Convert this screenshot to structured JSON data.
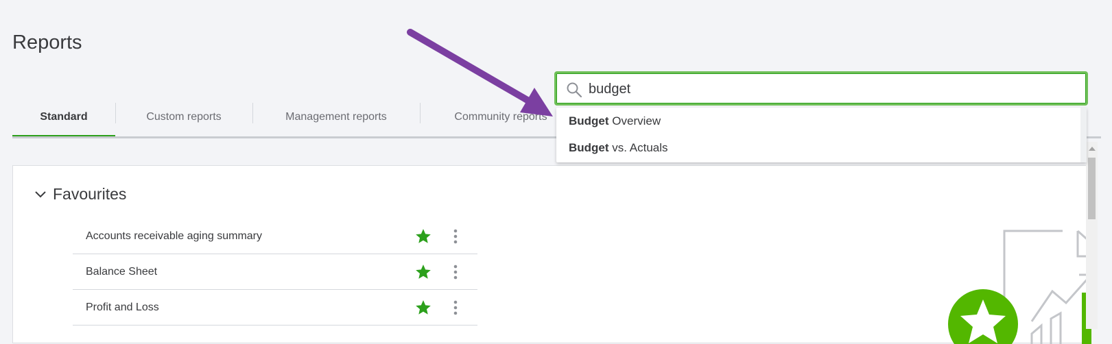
{
  "page": {
    "title": "Reports"
  },
  "tabs": [
    {
      "label": "Standard",
      "active": true
    },
    {
      "label": "Custom reports",
      "active": false
    },
    {
      "label": "Management reports",
      "active": false
    },
    {
      "label": "Community reports",
      "active": false
    }
  ],
  "search": {
    "value": "budget",
    "suggestions": [
      {
        "match": "Budget",
        "rest": " Overview"
      },
      {
        "match": "Budget",
        "rest": " vs. Actuals"
      }
    ]
  },
  "favourites": {
    "title": "Favourites",
    "items": [
      {
        "name": "Accounts receivable aging summary",
        "favourited": true
      },
      {
        "name": "Balance Sheet",
        "favourited": true
      },
      {
        "name": "Profit and Loss",
        "favourited": true
      }
    ]
  },
  "colors": {
    "accent": "#2ca01c",
    "annotation_arrow": "#7b3fa1"
  },
  "icons": [
    "search-icon",
    "chevron-down-icon",
    "star-icon",
    "more-vertical-icon",
    "arrow-annotation"
  ]
}
